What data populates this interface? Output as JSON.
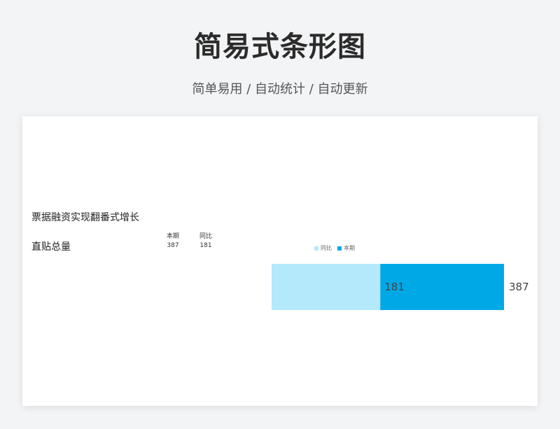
{
  "header": {
    "title": "简易式条形图",
    "subtitle": "简单易用 / 自动统计 / 自动更新"
  },
  "card": {
    "headline": "票据融资实现翻番式增长",
    "metric_label": "直贴总量",
    "columns": [
      {
        "label": "本期",
        "value": "387"
      },
      {
        "label": "同比",
        "value": "181"
      }
    ]
  },
  "colors": {
    "current": "#00a9e6",
    "previous": "#b3e9fb"
  },
  "chart_data": {
    "type": "bar",
    "orientation": "horizontal",
    "categories": [
      "直贴总量"
    ],
    "series": [
      {
        "name": "同比",
        "values": [
          181
        ]
      },
      {
        "name": "本期",
        "values": [
          387
        ]
      }
    ],
    "title": "票据融资实现翻番式增长",
    "legend": "top-center",
    "grid": false
  }
}
